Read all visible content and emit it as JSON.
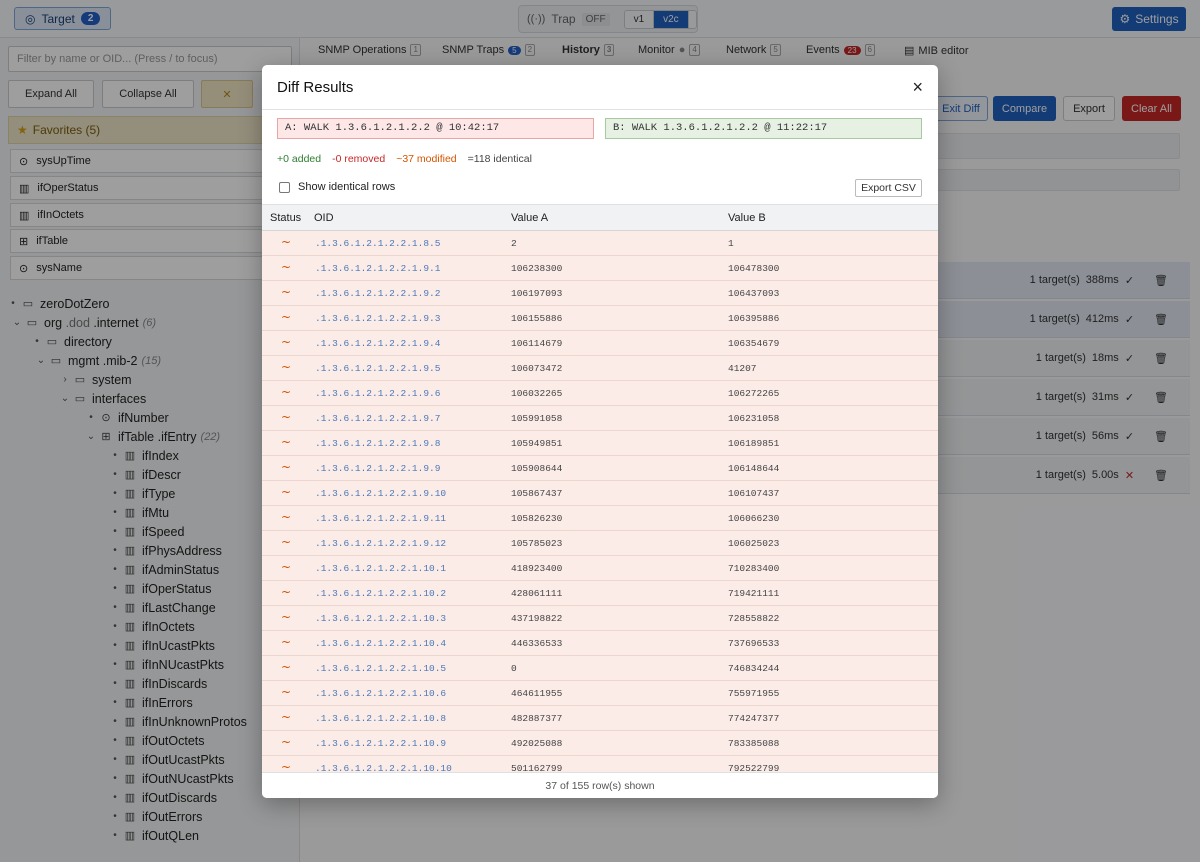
{
  "topbar": {
    "target_label": "Target",
    "target_count": "2",
    "trap_label": "Trap",
    "trap_state": "OFF",
    "versions": [
      "v1",
      "v2c",
      "v3"
    ],
    "active_version": "v2c",
    "settings_label": "Settings"
  },
  "sidebar": {
    "filter_placeholder": "Filter by name or OID... (Press / to focus)",
    "expand_all": "Expand All",
    "collapse_all": "Collapse All",
    "favorites_title": "Favorites (5)",
    "favorites": [
      {
        "label": "sysUpTime",
        "icon": "clock-icon"
      },
      {
        "label": "ifOperStatus",
        "icon": "column-icon"
      },
      {
        "label": "ifInOctets",
        "icon": "column-icon"
      },
      {
        "label": "ifTable",
        "icon": "table-icon"
      },
      {
        "label": "sysName",
        "icon": "clock-icon"
      }
    ],
    "tree": {
      "zeroDotZero": "zeroDotZero",
      "org": "org",
      "dod": ".dod",
      "internet": ".internet",
      "internet_count": "(6)",
      "directory": "directory",
      "mgmt": "mgmt",
      "mib2": ".mib-2",
      "mib2_count": "(15)",
      "system": "system",
      "interfaces": "interfaces",
      "ifNumber": "ifNumber",
      "ifTable": "ifTable",
      "ifEntry": ".ifEntry",
      "ifEntry_count": "(22)",
      "columns": [
        "ifIndex",
        "ifDescr",
        "ifType",
        "ifMtu",
        "ifSpeed",
        "ifPhysAddress",
        "ifAdminStatus",
        "ifOperStatus",
        "ifLastChange",
        "ifInOctets",
        "ifInUcastPkts",
        "ifInNUcastPkts",
        "ifInDiscards",
        "ifInErrors",
        "ifInUnknownProtos",
        "ifOutOctets",
        "ifOutUcastPkts",
        "ifOutNUcastPkts",
        "ifOutDiscards",
        "ifOutErrors",
        "ifOutQLen"
      ]
    }
  },
  "main": {
    "tabs": [
      {
        "label": "SNMP Operations",
        "key": "1"
      },
      {
        "label": "SNMP Traps",
        "badge": "5",
        "key": "2"
      },
      {
        "label": "History",
        "key": "3"
      },
      {
        "label": "Monitor",
        "key": "4"
      },
      {
        "label": "Network",
        "key": "5"
      },
      {
        "label": "Events",
        "badge": "23",
        "key": "6"
      },
      {
        "label": "MIB editor"
      }
    ],
    "exit_diff": "Exit Diff",
    "compare": "Compare",
    "export": "Export",
    "clear_all": "Clear All",
    "history": [
      {
        "targets": "1 target(s)",
        "time": "388ms",
        "ok": "✓"
      },
      {
        "targets": "1 target(s)",
        "time": "412ms",
        "ok": "✓"
      },
      {
        "targets": "1 target(s)",
        "time": "18ms",
        "ok": "✓"
      },
      {
        "targets": "1 target(s)",
        "time": "31ms",
        "ok": "✓"
      },
      {
        "targets": "1 target(s)",
        "time": "56ms",
        "ok": "✓"
      },
      {
        "targets": "1 target(s)",
        "time": "5.00s",
        "ok": "✕"
      }
    ]
  },
  "modal": {
    "title": "Diff Results",
    "close": "×",
    "snapshot_a": "A: WALK 1.3.6.1.2.1.2.2 @ 10:42:17",
    "snapshot_b": "B: WALK 1.3.6.1.2.1.2.2 @ 11:22:17",
    "stat_added": "+0 added",
    "stat_removed": "-0 removed",
    "stat_modified": "~37 modified",
    "stat_identical": "=118 identical",
    "show_identical": "Show identical rows",
    "export_csv": "Export CSV",
    "columns": {
      "status": "Status",
      "oid": "OID",
      "value_a": "Value A",
      "value_b": "Value B"
    },
    "rows": [
      {
        "status": "~",
        "oid": ".1.3.6.1.2.1.2.2.1.8.5",
        "a": "2",
        "b": "1"
      },
      {
        "status": "~",
        "oid": ".1.3.6.1.2.1.2.2.1.9.1",
        "a": "106238300",
        "b": "106478300"
      },
      {
        "status": "~",
        "oid": ".1.3.6.1.2.1.2.2.1.9.2",
        "a": "106197093",
        "b": "106437093"
      },
      {
        "status": "~",
        "oid": ".1.3.6.1.2.1.2.2.1.9.3",
        "a": "106155886",
        "b": "106395886"
      },
      {
        "status": "~",
        "oid": ".1.3.6.1.2.1.2.2.1.9.4",
        "a": "106114679",
        "b": "106354679"
      },
      {
        "status": "~",
        "oid": ".1.3.6.1.2.1.2.2.1.9.5",
        "a": "106073472",
        "b": "41207"
      },
      {
        "status": "~",
        "oid": ".1.3.6.1.2.1.2.2.1.9.6",
        "a": "106032265",
        "b": "106272265"
      },
      {
        "status": "~",
        "oid": ".1.3.6.1.2.1.2.2.1.9.7",
        "a": "105991058",
        "b": "106231058"
      },
      {
        "status": "~",
        "oid": ".1.3.6.1.2.1.2.2.1.9.8",
        "a": "105949851",
        "b": "106189851"
      },
      {
        "status": "~",
        "oid": ".1.3.6.1.2.1.2.2.1.9.9",
        "a": "105908644",
        "b": "106148644"
      },
      {
        "status": "~",
        "oid": ".1.3.6.1.2.1.2.2.1.9.10",
        "a": "105867437",
        "b": "106107437"
      },
      {
        "status": "~",
        "oid": ".1.3.6.1.2.1.2.2.1.9.11",
        "a": "105826230",
        "b": "106066230"
      },
      {
        "status": "~",
        "oid": ".1.3.6.1.2.1.2.2.1.9.12",
        "a": "105785023",
        "b": "106025023"
      },
      {
        "status": "~",
        "oid": ".1.3.6.1.2.1.2.2.1.10.1",
        "a": "418923400",
        "b": "710283400"
      },
      {
        "status": "~",
        "oid": ".1.3.6.1.2.1.2.2.1.10.2",
        "a": "428061111",
        "b": "719421111"
      },
      {
        "status": "~",
        "oid": ".1.3.6.1.2.1.2.2.1.10.3",
        "a": "437198822",
        "b": "728558822"
      },
      {
        "status": "~",
        "oid": ".1.3.6.1.2.1.2.2.1.10.4",
        "a": "446336533",
        "b": "737696533"
      },
      {
        "status": "~",
        "oid": ".1.3.6.1.2.1.2.2.1.10.5",
        "a": "0",
        "b": "746834244"
      },
      {
        "status": "~",
        "oid": ".1.3.6.1.2.1.2.2.1.10.6",
        "a": "464611955",
        "b": "755971955"
      },
      {
        "status": "~",
        "oid": ".1.3.6.1.2.1.2.2.1.10.8",
        "a": "482887377",
        "b": "774247377"
      },
      {
        "status": "~",
        "oid": ".1.3.6.1.2.1.2.2.1.10.9",
        "a": "492025088",
        "b": "783385088"
      },
      {
        "status": "~",
        "oid": ".1.3.6.1.2.1.2.2.1.10.10",
        "a": "501162799",
        "b": "792522799"
      }
    ],
    "footer": "37 of 155 row(s) shown"
  }
}
